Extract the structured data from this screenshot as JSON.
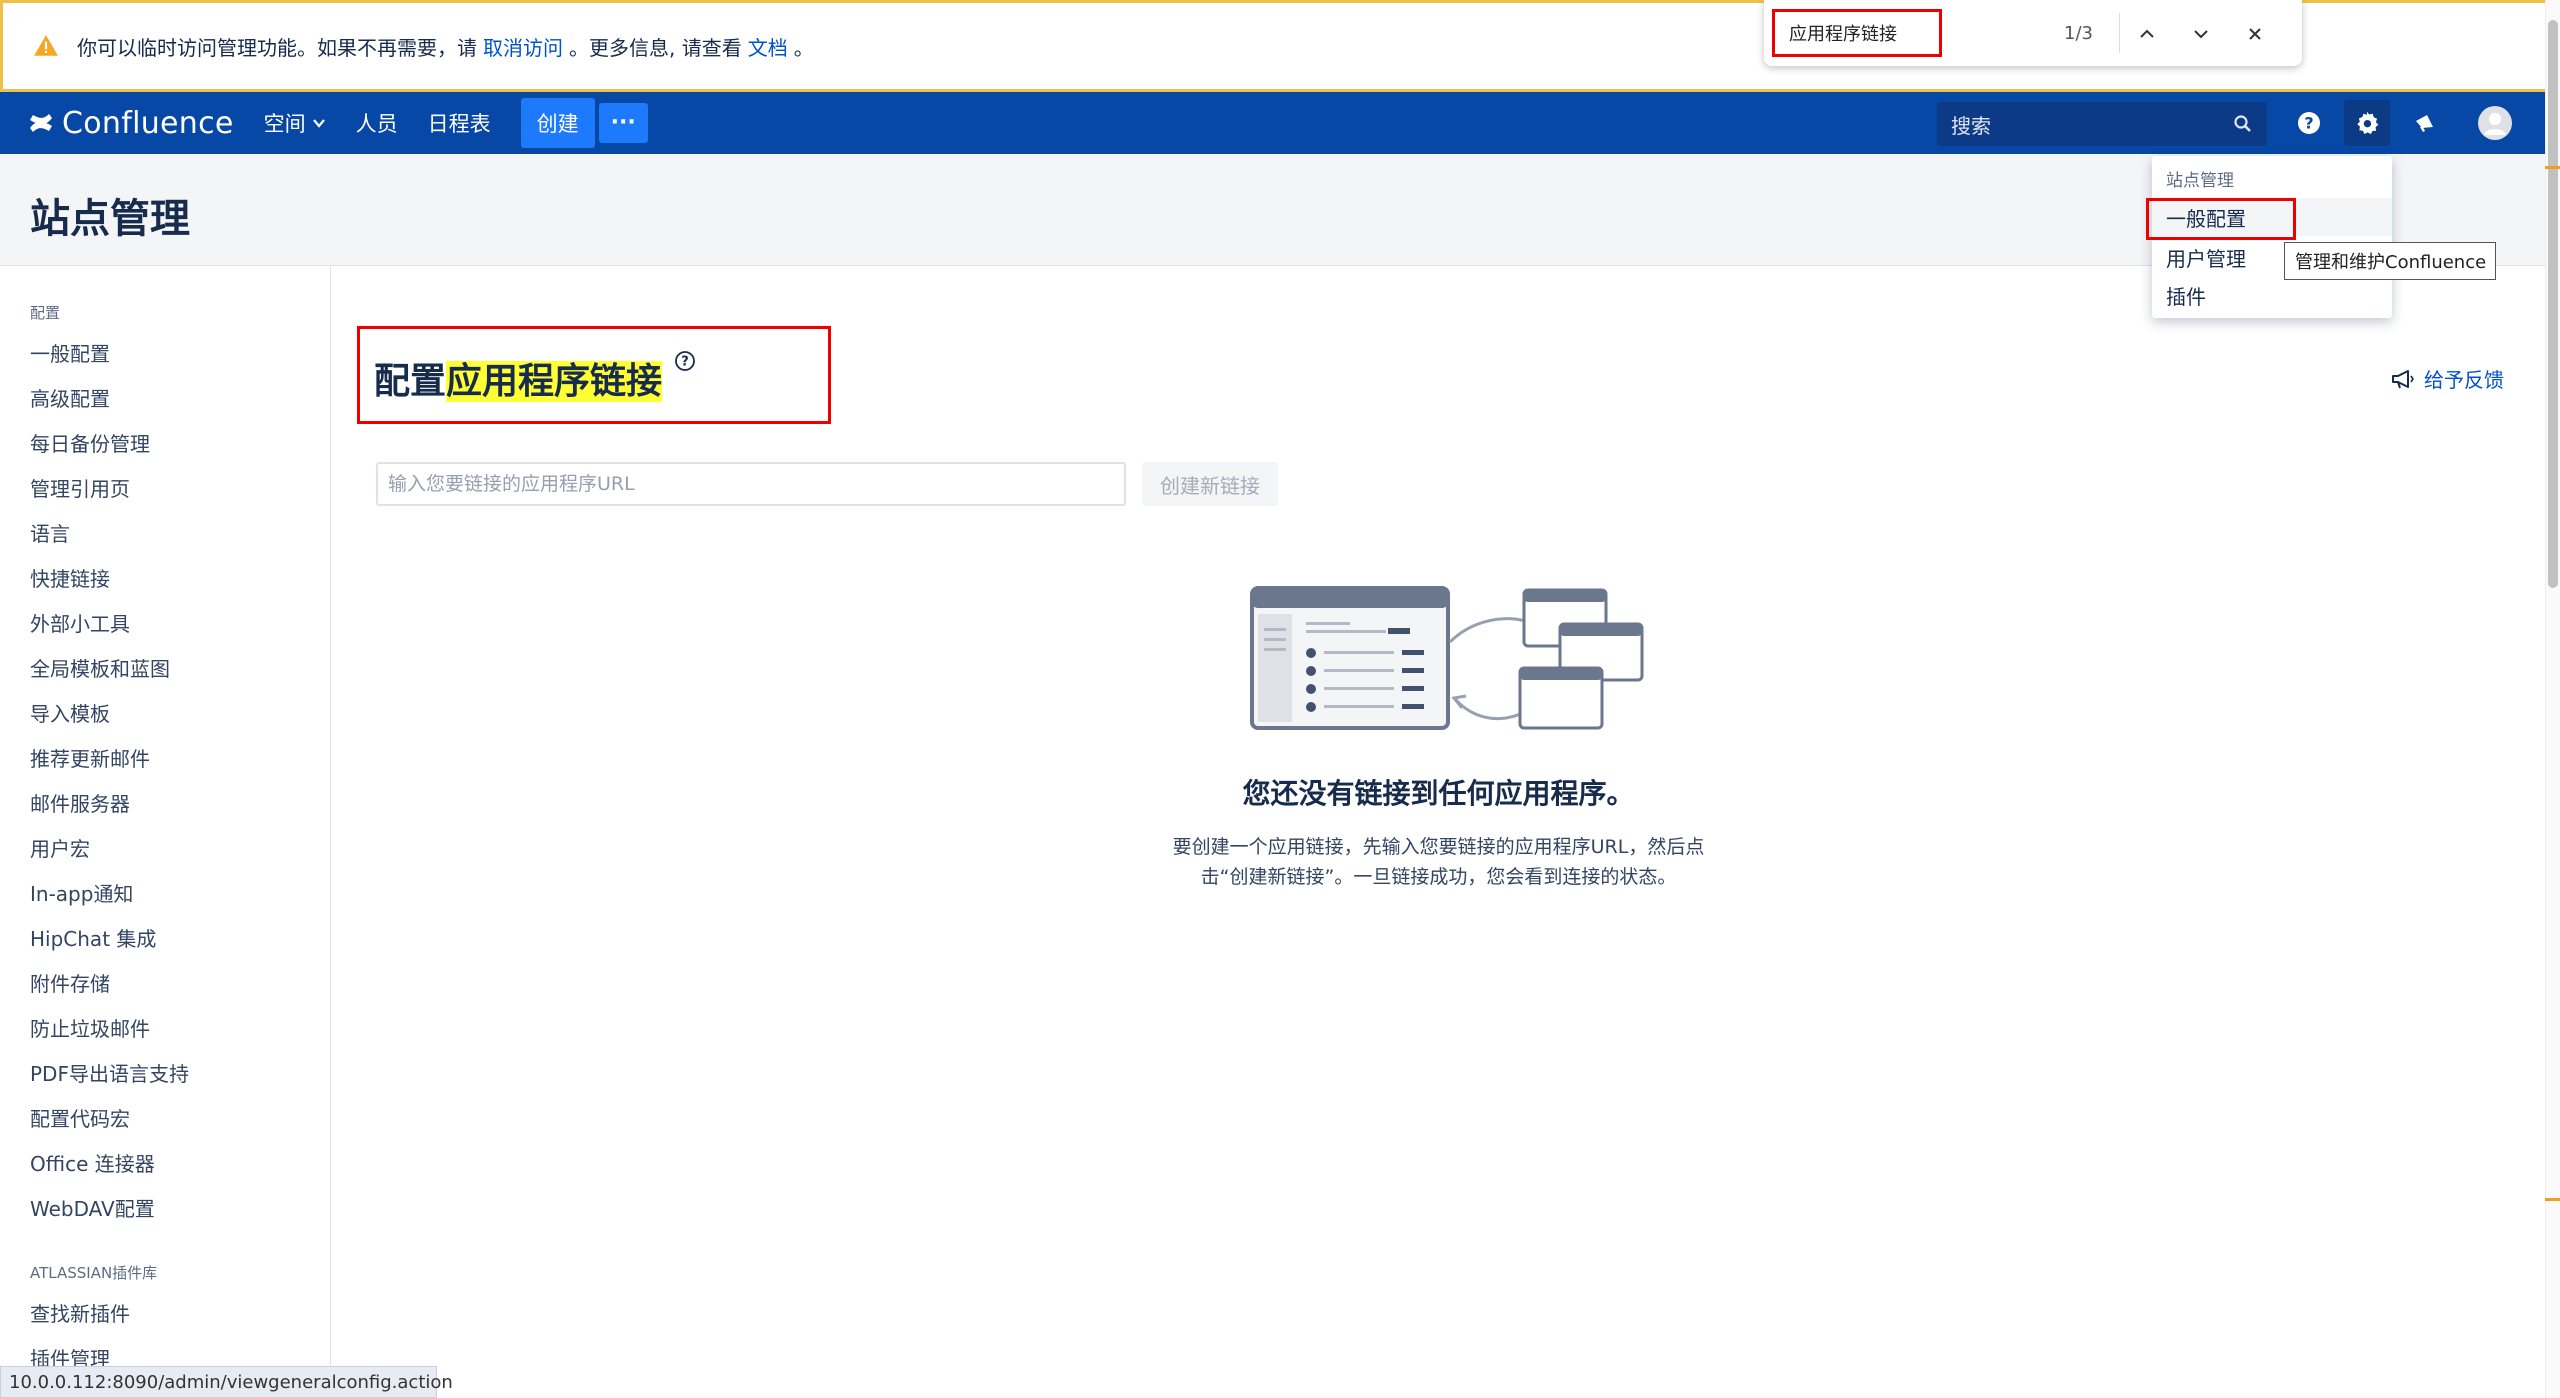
{
  "banner": {
    "text_before": "你可以临时访问管理功能。如果不再需要，请",
    "link_revoke": "取消访问",
    "text_middle": "。更多信息, 请查看",
    "link_docs": "文档",
    "text_after": "。"
  },
  "findbar": {
    "query": "应用程序链接",
    "count": "1/3"
  },
  "header": {
    "logo_text": "Confluence",
    "nav_spaces": "空间",
    "nav_people": "人员",
    "nav_calendar": "日程表",
    "create_label": "创建",
    "more_label": "···",
    "search_placeholder": "搜索"
  },
  "page_title": "站点管理",
  "sidebar": {
    "section_config": "配置",
    "config_items": [
      "一般配置",
      "高级配置",
      "每日备份管理",
      "管理引用页",
      "语言",
      "快捷链接",
      "外部小工具",
      "全局模板和蓝图",
      "导入模板",
      "推荐更新邮件",
      "邮件服务器",
      "用户宏",
      "In-app通知",
      "HipChat 集成",
      "附件存储",
      "防止垃圾邮件",
      "PDF导出语言支持",
      "配置代码宏",
      "Office 连接器",
      "WebDAV配置"
    ],
    "section_marketplace": "ATLASSIAN插件库",
    "marketplace_items": [
      "查找新插件",
      "插件管理"
    ]
  },
  "main": {
    "title_prefix": "配置",
    "title_highlight": "应用程序链接",
    "feedback_label": "给予反馈",
    "url_placeholder": "输入您要链接的应用程序URL",
    "create_link_label": "创建新链接",
    "empty_title": "您还没有链接到任何应用程序。",
    "empty_desc_line1": "要创建一个应用链接，先输入您要链接的应用程序URL，然后点",
    "empty_desc_line2": "击“创建新链接”。一旦链接成功，您会看到连接的状态。"
  },
  "dropdown": {
    "heading": "站点管理",
    "items": [
      "一般配置",
      "用户管理",
      "插件"
    ]
  },
  "tooltip": "管理和维护Confluence",
  "status_url": "10.0.0.112:8090/admin/viewgeneralconfig.action",
  "colors": {
    "header_bg": "#0747a6",
    "create_button": "#1d7afc",
    "link": "#0052cc",
    "highlight": "#ffff33",
    "annotation_red": "#ee0000"
  },
  "icons": {
    "warning": "warning-icon",
    "help": "help-icon",
    "settings": "gear-icon",
    "notifications": "megaphone-icon",
    "avatar": "avatar-icon",
    "search": "search-icon"
  }
}
